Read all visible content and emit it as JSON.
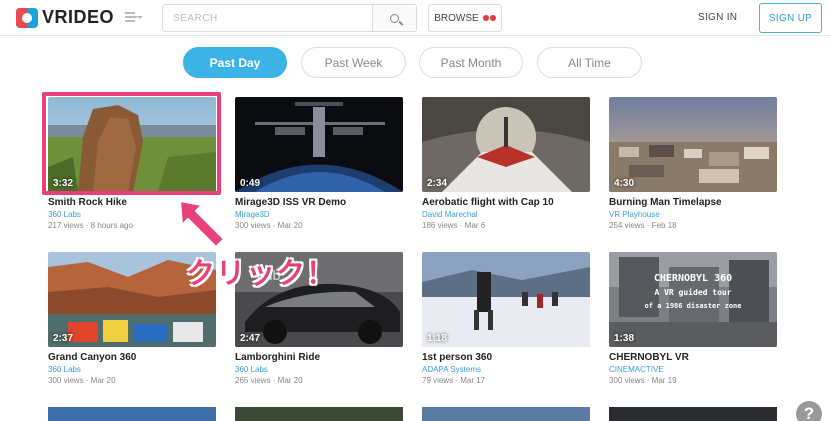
{
  "header": {
    "logo_text": "VRIDEO",
    "search_placeholder": "SEARCH",
    "browse_label": "BROWSE",
    "sign_in": "SIGN IN",
    "sign_up": "SIGN UP"
  },
  "tabs": [
    {
      "label": "Past Day",
      "active": true
    },
    {
      "label": "Past Week",
      "active": false
    },
    {
      "label": "Past Month",
      "active": false
    },
    {
      "label": "All Time",
      "active": false
    }
  ],
  "videos": [
    {
      "title": "Smith Rock Hike",
      "channel": "360 Labs",
      "meta": "217 views · 8 hours ago",
      "duration": "3:32"
    },
    {
      "title": "Mirage3D ISS VR Demo",
      "channel": "Mirage3D",
      "meta": "300 views · Mar 20",
      "duration": "0:49"
    },
    {
      "title": "Aerobatic flight with Cap 10",
      "channel": "David Marechal",
      "meta": "186 views · Mar 6",
      "duration": "2:34"
    },
    {
      "title": "Burning Man Timelapse",
      "channel": "VR Playhouse",
      "meta": "254 views · Feb 18",
      "duration": "4:30"
    },
    {
      "title": "Grand Canyon 360",
      "channel": "360 Labs",
      "meta": "300 views · Mar 20",
      "duration": "2:37"
    },
    {
      "title": "Lamborghini Ride",
      "channel": "360 Labs",
      "meta": "265 views · Mar 20",
      "duration": "2:47"
    },
    {
      "title": "1st person 360",
      "channel": "ADAPA Systems",
      "meta": "79 views · Mar 17",
      "duration": "1:18"
    },
    {
      "title": "CHERNOBYL VR",
      "channel": "CINEMACTIVE",
      "meta": "300 views · Mar 19",
      "duration": "1:38"
    }
  ],
  "thumb_text": {
    "hub": "hub",
    "chernobyl_line1": "CHERNOBYL 360",
    "chernobyl_line2": "A VR guided tour",
    "chernobyl_line3": "of a 1986 disaster zone"
  },
  "annotation": "クリック！",
  "help": "?",
  "colors": {
    "accent": "#3bb3e6",
    "highlight": "#e8407a",
    "link": "#3a9fd8"
  }
}
